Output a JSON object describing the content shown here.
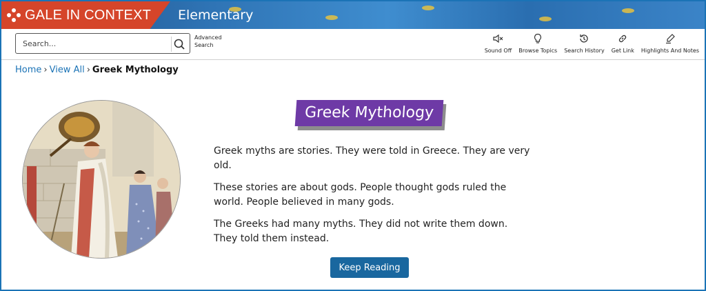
{
  "brand": {
    "name": "GALE IN CONTEXT",
    "product": "Elementary"
  },
  "search": {
    "placeholder": "Search..."
  },
  "advanced_search": "Advanced Search",
  "tools": [
    {
      "label": "Sound Off",
      "icon": "speaker-mute-icon"
    },
    {
      "label": "Browse Topics",
      "icon": "lightbulb-icon"
    },
    {
      "label": "Search History",
      "icon": "history-icon"
    },
    {
      "label": "Get Link",
      "icon": "link-icon"
    },
    {
      "label": "Highlights And Notes",
      "icon": "pen-icon"
    }
  ],
  "breadcrumb": {
    "home": "Home",
    "view_all": "View All",
    "current": "Greek Mythology"
  },
  "article": {
    "title": "Greek Mythology",
    "paragraphs": [
      "Greek myths are stories. They were told in Greece. They are very old.",
      "These stories are about gods. People thought gods ruled the world. People believed in many gods.",
      "The Greeks had many myths. They did not write them down. They told them instead."
    ],
    "keep_reading": "Keep Reading"
  },
  "colors": {
    "brand": "#d5452a",
    "header": "#2f74b5",
    "title_bg": "#6e3aa6",
    "button": "#19679f",
    "link": "#1b73b6"
  }
}
